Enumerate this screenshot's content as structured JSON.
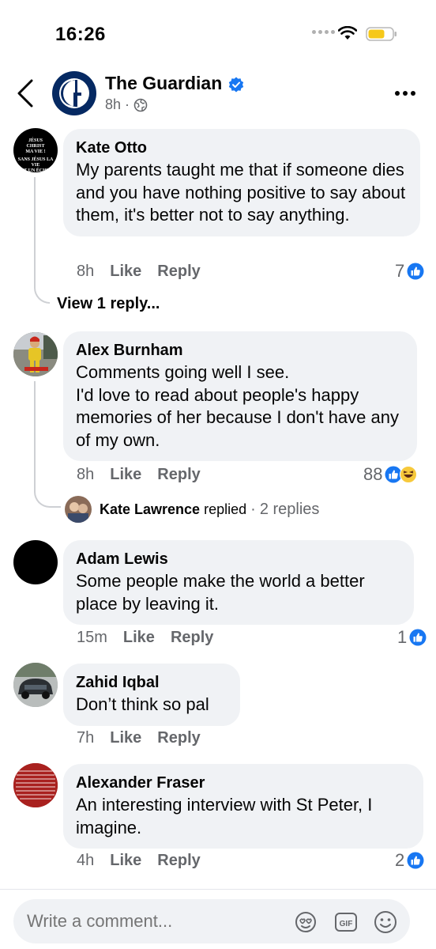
{
  "status_bar": {
    "time": "16:26"
  },
  "header": {
    "page_name": "The Guardian",
    "time": "8h",
    "separator": "·"
  },
  "comments": [
    {
      "author": "Kate Otto",
      "avatar_text": "JÉSUS CHRIST MA VIE ! SANS JÉSUS LA VIE EST UN ÉCHEC",
      "text": "My parents taught me that if someone dies and you have nothing positive to say about them, it's better not to say anything.",
      "time": "8h",
      "like": "Like",
      "reply": "Reply",
      "reactions": "7",
      "view_replies": "View 1 reply..."
    },
    {
      "author": "Alex Burnham",
      "text": "Comments going well I see.\nI'd love to read about people's happy memories of her because I don't have any of my own.",
      "time": "8h",
      "like": "Like",
      "reply": "Reply",
      "reactions": "88",
      "replied_by": "Kate Lawrence",
      "replied_label": "replied",
      "replied_sep": "·",
      "replies_count": "2 replies"
    },
    {
      "author": "Adam Lewis",
      "text": "Some people make the world a better place by leaving it.",
      "time": "15m",
      "like": "Like",
      "reply": "Reply",
      "reactions": "1"
    },
    {
      "author": "Zahid Iqbal",
      "text": "Don’t think so pal",
      "time": "7h",
      "like": "Like",
      "reply": "Reply"
    },
    {
      "author": "Alexander Fraser",
      "text": "An interesting interview with St Peter, I imagine.",
      "time": "4h",
      "like": "Like",
      "reply": "Reply",
      "reactions": "2"
    }
  ],
  "composer": {
    "placeholder": "Write a comment..."
  },
  "colors": {
    "like_blue": "#1877f2",
    "bubble": "#f0f2f5",
    "guardian_navy": "#052962",
    "muted": "#65676b"
  }
}
